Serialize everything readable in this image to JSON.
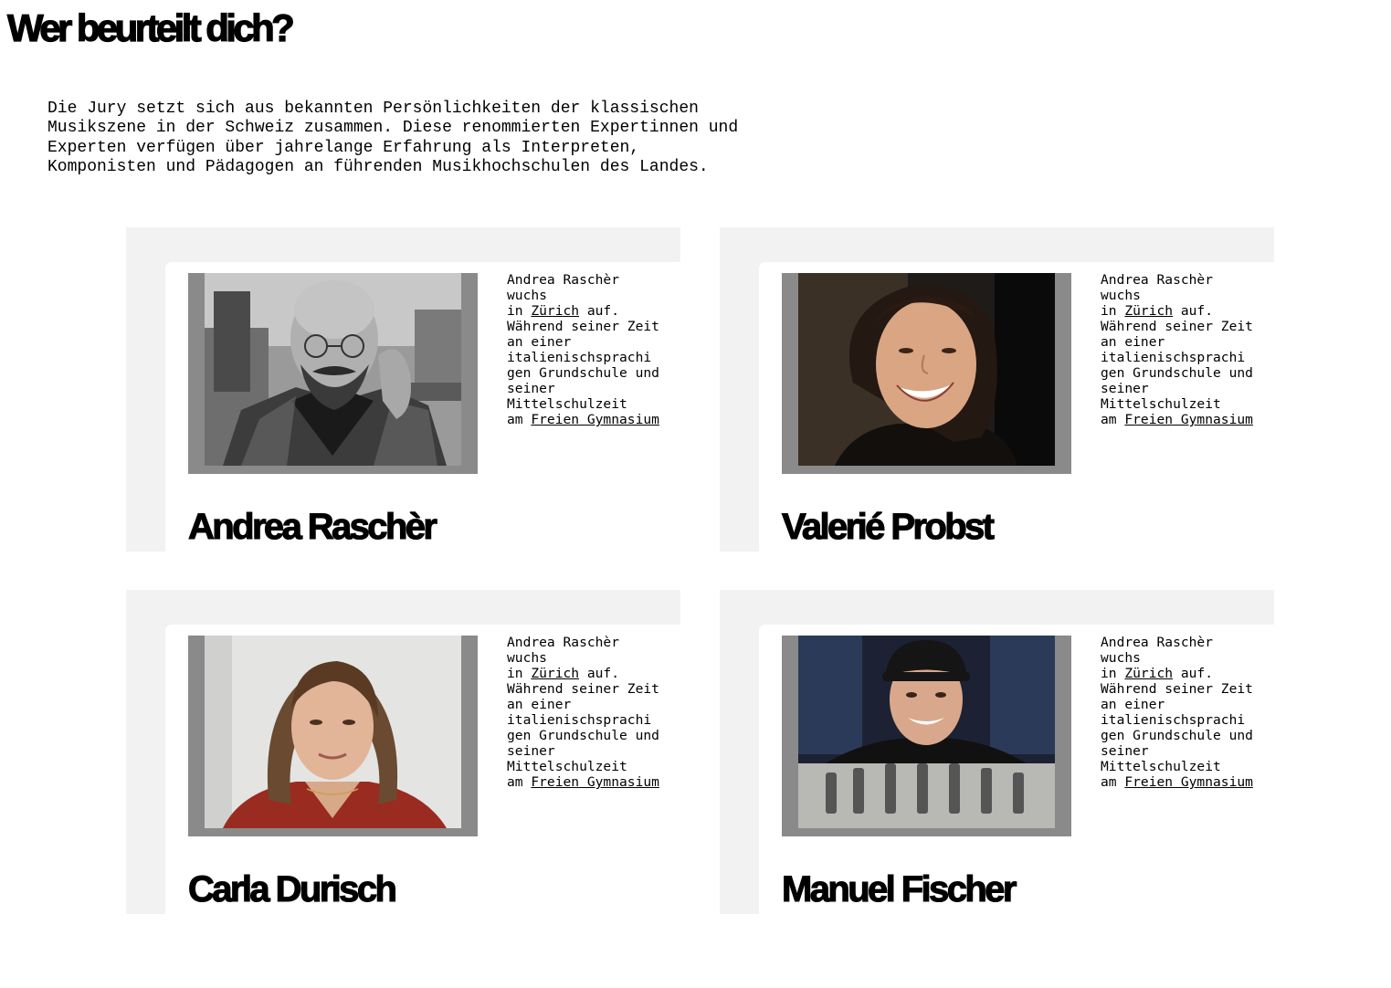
{
  "heading": "Wer beurteilt dich?",
  "intro_lines": [
    "Die Jury setzt sich aus bekannten Persönlichkeiten der klassischen",
    "Musikszene in der Schweiz zusammen. Diese renommierten Expertinnen und",
    "Experten verfügen über jahrelange Erfahrung als Interpreten,",
    "Komponisten und Pädagogen an führenden Musikhochschulen des Landes."
  ],
  "jury": [
    {
      "name": "Andrea Raschèr",
      "photo": "portrait-man-glasses-beard-bw",
      "bio": {
        "l1": "Andrea Raschèr",
        "l2": "wuchs",
        "l3_pre": "in ",
        "l3_link": "Zürich",
        "l3_post": " auf.",
        "l4": "Während seiner Zeit",
        "l5": "an einer",
        "l6": "italienischsprachi",
        "l7": "gen Grundschule und",
        "l8": "seiner",
        "l9": "Mittelschulzeit",
        "l10_pre": "am ",
        "l10_link": "Freien Gymnasium"
      }
    },
    {
      "name": "Valerié Probst",
      "photo": "portrait-woman-smiling-dark-hair",
      "bio": {
        "l1": "Andrea Raschèr",
        "l2": "wuchs",
        "l3_pre": "in ",
        "l3_link": "Zürich",
        "l3_post": " auf.",
        "l4": "Während seiner Zeit",
        "l5": "an einer",
        "l6": "italienischsprachi",
        "l7": "gen Grundschule und",
        "l8": "seiner",
        "l9": "Mittelschulzeit",
        "l10_pre": "am ",
        "l10_link": "Freien Gymnasium"
      }
    },
    {
      "name": "Carla Durisch",
      "photo": "portrait-woman-red-jacket",
      "bio": {
        "l1": "Andrea Raschèr",
        "l2": "wuchs",
        "l3_pre": "in ",
        "l3_link": "Zürich",
        "l3_post": " auf.",
        "l4": "Während seiner Zeit",
        "l5": "an einer",
        "l6": "italienischsprachi",
        "l7": "gen Grundschule und",
        "l8": "seiner",
        "l9": "Mittelschulzeit",
        "l10_pre": "am ",
        "l10_link": "Freien Gymnasium"
      }
    },
    {
      "name": "Manuel Fischer",
      "photo": "portrait-man-cap-mixing-desk",
      "bio": {
        "l1": "Andrea Raschèr",
        "l2": "wuchs",
        "l3_pre": "in ",
        "l3_link": "Zürich",
        "l3_post": " auf.",
        "l4": "Während seiner Zeit",
        "l5": "an einer",
        "l6": "italienischsprachi",
        "l7": "gen Grundschule und",
        "l8": "seiner",
        "l9": "Mittelschulzeit",
        "l10_pre": "am ",
        "l10_link": "Freien Gymnasium"
      }
    }
  ]
}
